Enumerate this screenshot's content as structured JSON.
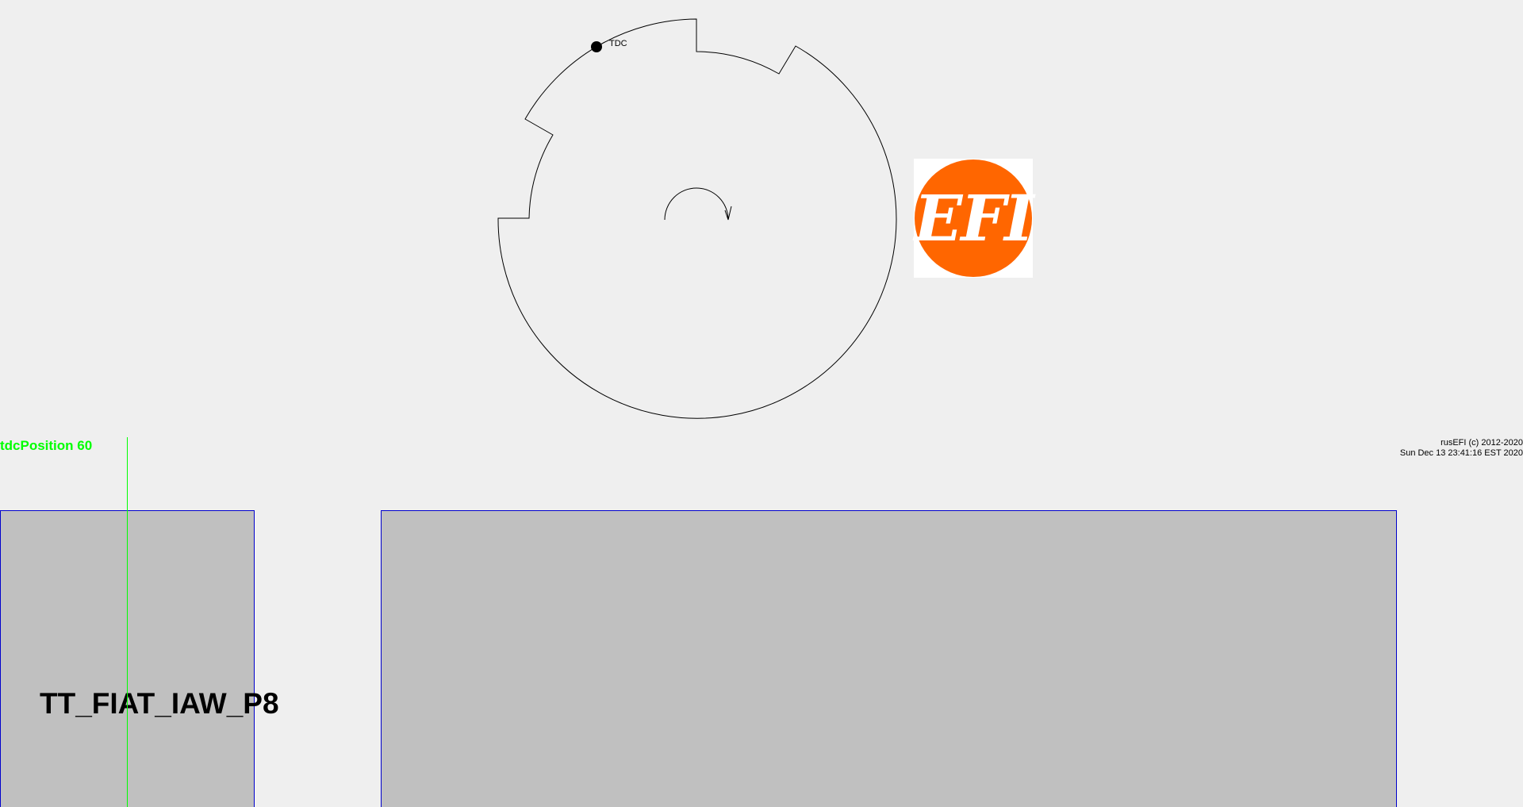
{
  "wheel": {
    "tdc_label": "TDC"
  },
  "logo": {
    "text": "EFI",
    "bg_color": "#ff6600",
    "text_color": "#ffffff"
  },
  "tdc_position": {
    "label": "tdcPosition 60",
    "color": "#00ff00"
  },
  "footer": {
    "copyright": "rusEFI (c) 2012-2020",
    "timestamp": "Sun Dec 13 23:41:16 EST 2020"
  },
  "trigger": {
    "name": "TT_FIAT_IAW_P8"
  },
  "colors": {
    "background": "#efefef",
    "panel_fill": "#c0c0c0",
    "panel_border": "#0000cc"
  }
}
